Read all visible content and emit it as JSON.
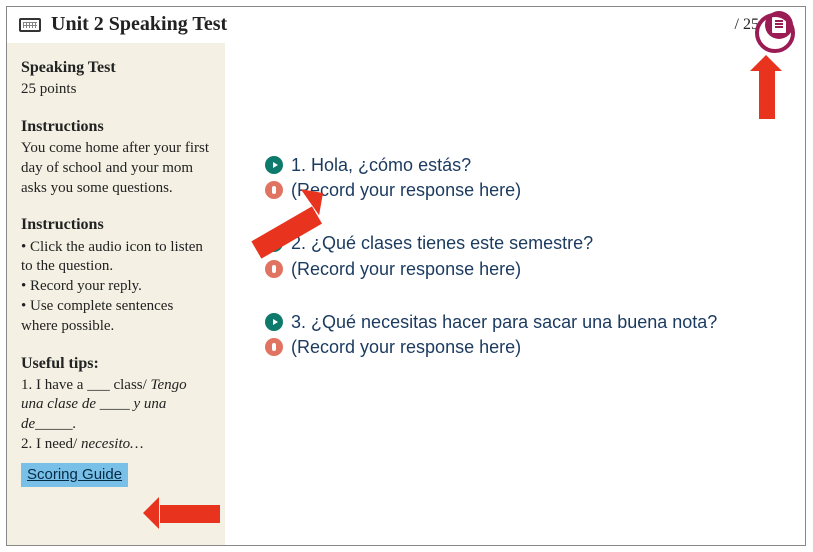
{
  "header": {
    "title": "Unit 2 Speaking Test",
    "page_total": "/ 25"
  },
  "sidebar": {
    "test_title": "Speaking Test",
    "points": "25 points",
    "instr1_head": "Instructions",
    "instr1_body": "You come home after your first day of school and your mom asks you some questions.",
    "instr2_head": "Instructions",
    "instr2_items": [
      "• Click the audio icon to listen to the question.",
      "• Record your reply.",
      "• Use complete sentences where possible."
    ],
    "tips_head": "Useful tips:",
    "tips_1_a": "1. I have a ___ class/",
    "tips_1_b": "Tengo una clase de ____ y una de_____.",
    "tips_2_a": "2. I need/ ",
    "tips_2_b": "necesito…",
    "scoring": "Scoring Guide"
  },
  "questions": [
    {
      "num": "1.",
      "prompt": "Hola, ¿cómo estás?",
      "record": "(Record your response here)"
    },
    {
      "num": "2.",
      "prompt": "¿Qué clases tienes este semestre?",
      "record": "(Record your response here)"
    },
    {
      "num": "3.",
      "prompt": "¿Qué necesitas hacer para sacar una buena nota?",
      "record": "(Record your response here)"
    }
  ]
}
